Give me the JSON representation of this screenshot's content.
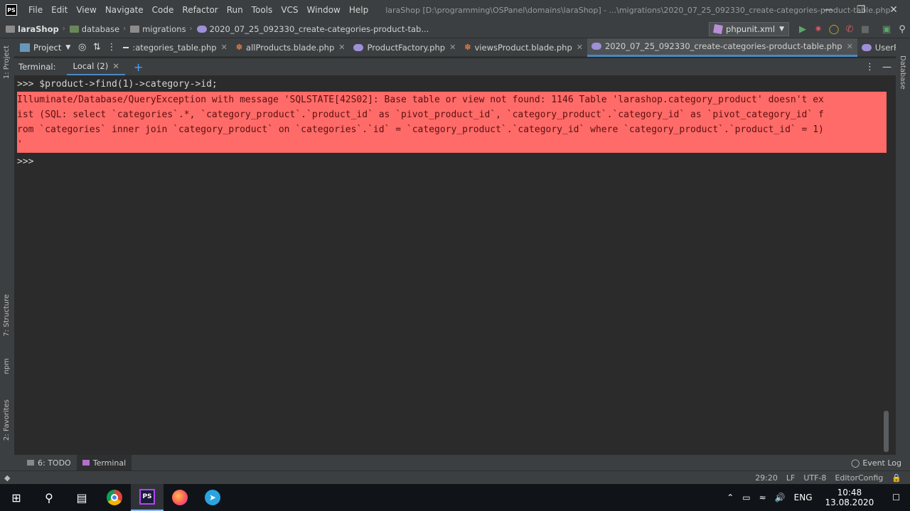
{
  "titlebar": {
    "app_logo": "PS",
    "menu": [
      "File",
      "Edit",
      "View",
      "Navigate",
      "Code",
      "Refactor",
      "Run",
      "Tools",
      "VCS",
      "Window",
      "Help"
    ],
    "title": "laraShop [D:\\programming\\OSPanel\\domains\\laraShop] - ...\\migrations\\2020_07_25_092330_create-categories-product-table.php"
  },
  "navbar": {
    "crumbs": [
      "laraShop",
      "database",
      "migrations",
      "2020_07_25_092330_create-categories-product-tab..."
    ],
    "run_config": "phpunit.xml"
  },
  "tabs": {
    "project_label": "Project",
    "items": [
      {
        "label": ":ategories_table.php",
        "icon": "dash-icon"
      },
      {
        "label": "allProducts.blade.php",
        "icon": "blade-icon"
      },
      {
        "label": "ProductFactory.php",
        "icon": "php-icon"
      },
      {
        "label": "viewsProduct.blade.php",
        "icon": "blade-icon"
      },
      {
        "label": "2020_07_25_092330_create-categories-product-table.php",
        "icon": "php-icon",
        "active": true
      },
      {
        "label": "UserFactory.php",
        "icon": "php-icon"
      }
    ]
  },
  "left_stripe": {
    "project": "1: Project",
    "structure": "7: Structure",
    "npm": "npm",
    "favorites": "2: Favorites"
  },
  "right_stripe": {
    "database": "Database"
  },
  "terminal": {
    "label": "Terminal:",
    "tab": "Local (2)",
    "command": ">>> $product->find(1)->category->id;",
    "error_lines": [
      "Illuminate/Database/QueryException with message 'SQLSTATE[42S02]: Base table or view not found: 1146 Table 'larashop.category_product' doesn't ex",
      "ist (SQL: select `categories`.*, `category_product`.`product_id` as `pivot_product_id`, `category_product`.`category_id` as `pivot_category_id` f",
      "rom `categories` inner join `category_product` on `categories`.`id` = `category_product`.`category_id` where `category_product`.`product_id` = 1)",
      "'"
    ],
    "prompt": ">>>"
  },
  "bottom_tabs": {
    "todo": "6: TODO",
    "terminal": "Terminal",
    "event_log": "Event Log"
  },
  "statusbar": {
    "position": "29:20",
    "line_sep": "LF",
    "encoding": "UTF-8",
    "editor_config": "EditorConfig"
  },
  "taskbar": {
    "lang": "ENG",
    "time": "10:48",
    "date": "13.08.2020"
  }
}
